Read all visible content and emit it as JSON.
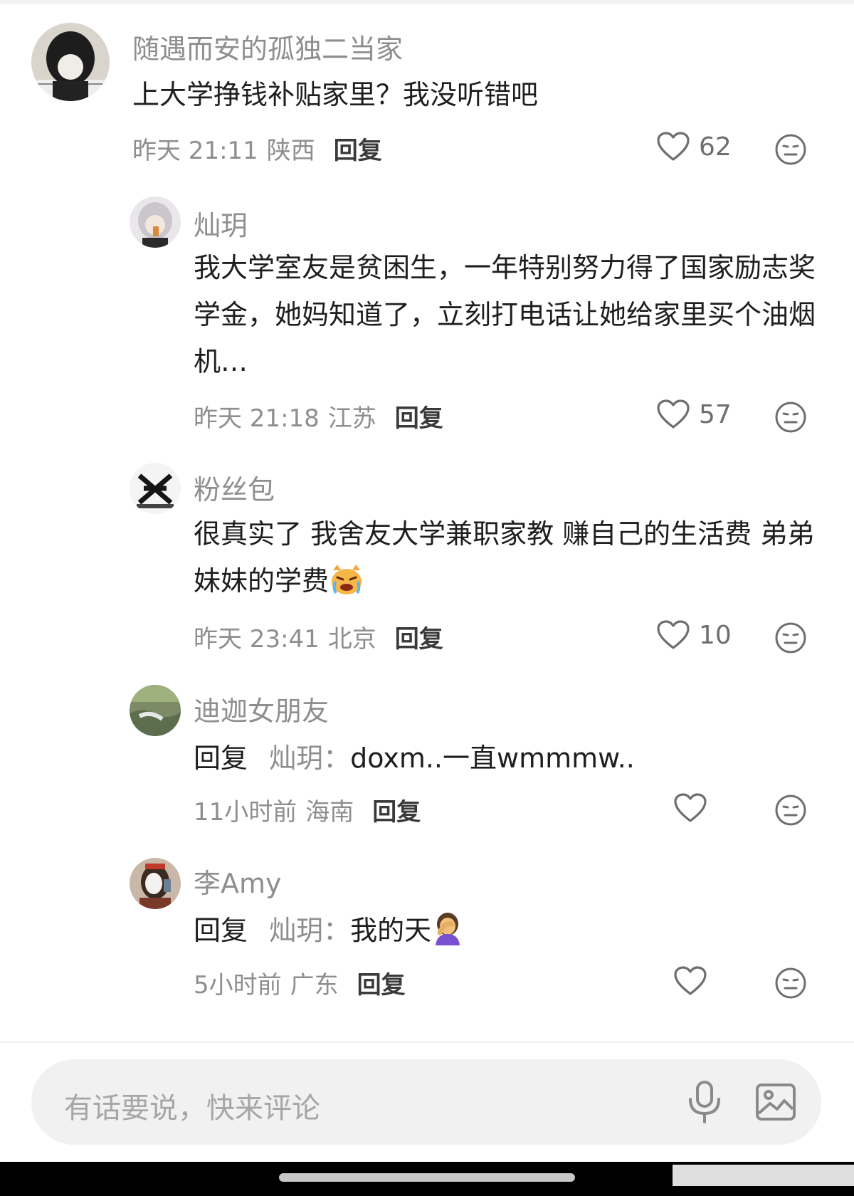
{
  "comments": [
    {
      "username": "随遇而安的孤独二当家",
      "text": "上大学挣钱补贴家里？我没听错吧",
      "time": "昨天 21:11",
      "location": "陕西",
      "reply_label": "回复",
      "likes": "62"
    },
    {
      "username": "灿玥",
      "text": "我大学室友是贫困生，一年特别努力得了国家励志奖学金，她妈知道了，立刻打电话让她给家里买个油烟机…",
      "time": "昨天 21:18",
      "location": "江苏",
      "reply_label": "回复",
      "likes": "57"
    },
    {
      "username": "粉丝包",
      "text": "很真实了 我舍友大学兼职家教 赚自己的生活费 弟弟妹妹的学费",
      "emoji": "crying-angry-cat",
      "time": "昨天 23:41",
      "location": "北京",
      "reply_label": "回复",
      "likes": "10"
    },
    {
      "username": "迪迦女朋友",
      "reply_prefix": "回复",
      "reply_target": "灿玥：",
      "text": "doxm..一直wmmmw..",
      "time": "11小时前",
      "location": "海南",
      "reply_label": "回复",
      "likes": ""
    },
    {
      "username": "李Amy",
      "reply_prefix": "回复",
      "reply_target": "灿玥：",
      "text": "我的天",
      "emoji": "facepalm-woman",
      "time": "5小时前",
      "location": "广东",
      "reply_label": "回复",
      "likes": ""
    }
  ],
  "composer": {
    "placeholder": "有话要说，快来评论",
    "icons": [
      "microphone-icon",
      "image-icon"
    ]
  },
  "icons": {
    "like": "heart-outline-icon",
    "dislike": "meh-face-icon"
  },
  "colors": {
    "secondary_text": "#8e8e8e",
    "primary_text": "#1e1e1e",
    "composer_bg": "#f1f1f1"
  }
}
